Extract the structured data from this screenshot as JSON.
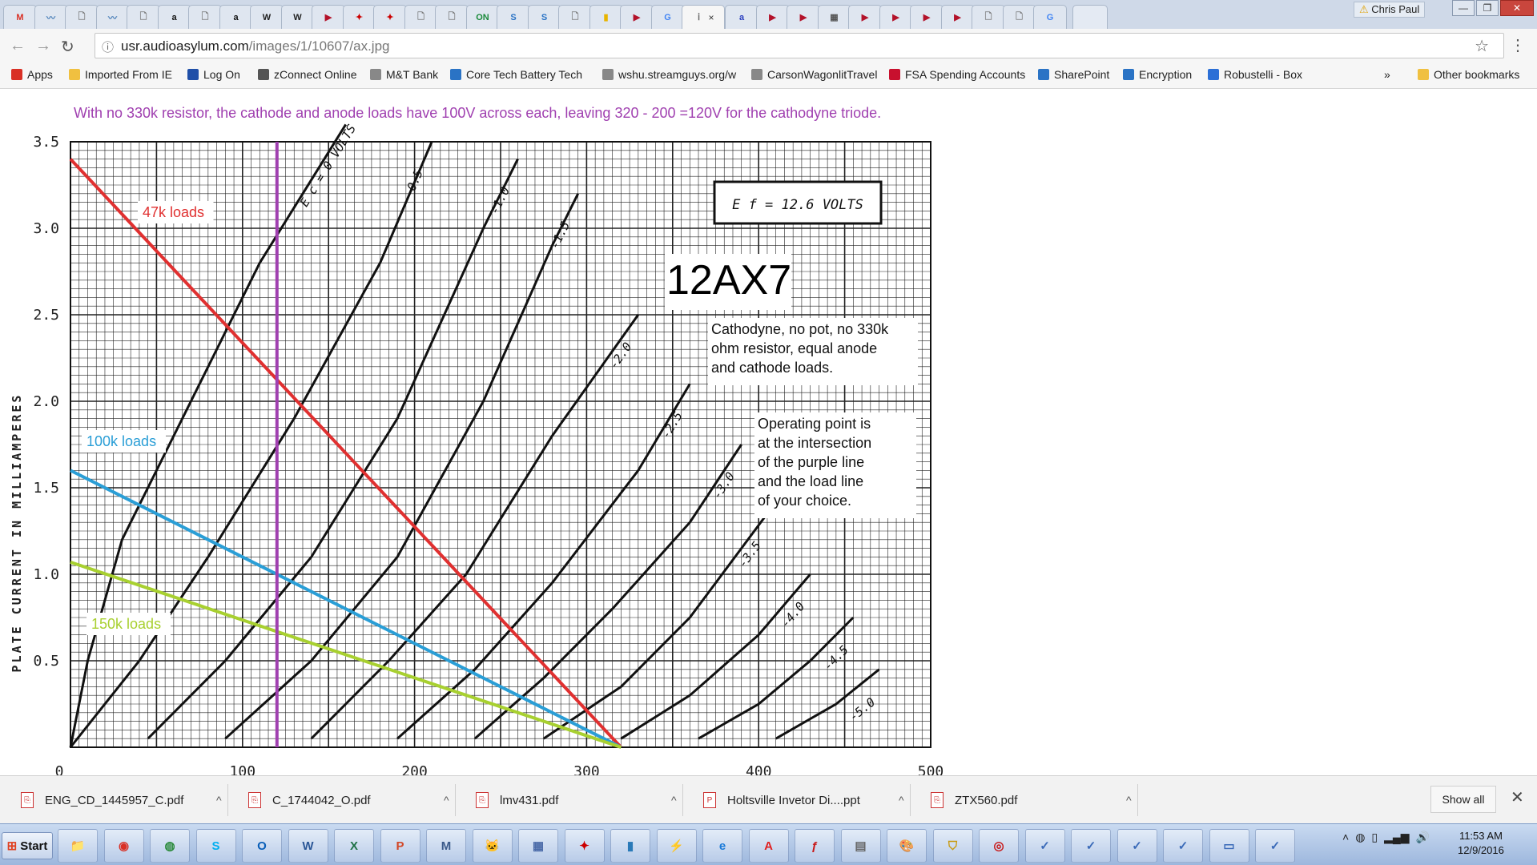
{
  "browser": {
    "profile_name": "Chris Paul",
    "url_host": "usr.audioasylum.com",
    "url_path": "/images/1/10607/ax.jpg",
    "tab_active_close": "×"
  },
  "tabs": [
    {
      "icon": "gmail-icon",
      "glyph": "M",
      "color": "#d93025"
    },
    {
      "icon": "site-icon",
      "glyph": "〰",
      "color": "#4a7fb8"
    },
    {
      "icon": "page-icon",
      "glyph": "🗋",
      "color": "#777"
    },
    {
      "icon": "site-icon",
      "glyph": "〰",
      "color": "#4a7fb8"
    },
    {
      "icon": "page-icon",
      "glyph": "🗋",
      "color": "#777"
    },
    {
      "icon": "amazon-icon",
      "glyph": "a",
      "color": "#111"
    },
    {
      "icon": "page-icon",
      "glyph": "🗋",
      "color": "#777"
    },
    {
      "icon": "amazon-icon",
      "glyph": "a",
      "color": "#111"
    },
    {
      "icon": "wikipedia-icon",
      "glyph": "W",
      "color": "#222"
    },
    {
      "icon": "wikipedia-icon",
      "glyph": "W",
      "color": "#222"
    },
    {
      "icon": "red-site-icon",
      "glyph": "▶",
      "color": "#b3122a"
    },
    {
      "icon": "ti-icon",
      "glyph": "✦",
      "color": "#cc0000"
    },
    {
      "icon": "ti-icon",
      "glyph": "✦",
      "color": "#cc0000"
    },
    {
      "icon": "page-icon",
      "glyph": "🗋",
      "color": "#777"
    },
    {
      "icon": "page-icon",
      "glyph": "🗋",
      "color": "#777"
    },
    {
      "icon": "on-semi-icon",
      "glyph": "ON",
      "color": "#1a8a3a"
    },
    {
      "icon": "sharepoint-icon",
      "glyph": "S",
      "color": "#2a73c5"
    },
    {
      "icon": "sharepoint-icon",
      "glyph": "S",
      "color": "#2a73c5"
    },
    {
      "icon": "page-icon",
      "glyph": "🗋",
      "color": "#777"
    },
    {
      "icon": "flag-icon",
      "glyph": "▮",
      "color": "#e8b400"
    },
    {
      "icon": "red-site-icon",
      "glyph": "▶",
      "color": "#b3122a"
    },
    {
      "icon": "google-icon",
      "glyph": "G",
      "color": "#4285f4"
    },
    {
      "icon": "active-tab-icon",
      "glyph": "ⅰ",
      "color": "#666",
      "active": true
    },
    {
      "icon": "audioasylum-icon",
      "glyph": "a",
      "color": "#2b3fbf"
    },
    {
      "icon": "red-site-icon",
      "glyph": "▶",
      "color": "#b3122a"
    },
    {
      "icon": "red-site-icon",
      "glyph": "▶",
      "color": "#b3122a"
    },
    {
      "icon": "grid-icon",
      "glyph": "▦",
      "color": "#555"
    },
    {
      "icon": "red-site-icon",
      "glyph": "▶",
      "color": "#b3122a"
    },
    {
      "icon": "red-site-icon",
      "glyph": "▶",
      "color": "#b3122a"
    },
    {
      "icon": "red-site-icon",
      "glyph": "▶",
      "color": "#b3122a"
    },
    {
      "icon": "red-site-icon",
      "glyph": "▶",
      "color": "#b3122a"
    },
    {
      "icon": "page-icon",
      "glyph": "🗋",
      "color": "#777"
    },
    {
      "icon": "page-icon",
      "glyph": "🗋",
      "color": "#777"
    },
    {
      "icon": "google-icon",
      "glyph": "G",
      "color": "#4285f4"
    }
  ],
  "bookmarks": [
    {
      "label": "Apps",
      "icon": "apps-icon",
      "color": "#d93025"
    },
    {
      "label": "Imported From IE",
      "icon": "folder-icon",
      "color": "#f0c040"
    },
    {
      "label": "Log On",
      "icon": "logon-icon",
      "color": "#1f4fa8"
    },
    {
      "label": "zConnect Online",
      "icon": "gear-icon",
      "color": "#555"
    },
    {
      "label": "M&T Bank",
      "icon": "page-icon",
      "color": "#888"
    },
    {
      "label": "Core Tech Battery Tech",
      "icon": "sharepoint-icon",
      "color": "#2a73c5"
    },
    {
      "label": "wshu.streamguys.org/w",
      "icon": "page-icon",
      "color": "#888"
    },
    {
      "label": "CarsonWagonlitTravel",
      "icon": "page-icon",
      "color": "#888"
    },
    {
      "label": "FSA Spending Accounts",
      "icon": "fsa-icon",
      "color": "#c8102e"
    },
    {
      "label": "SharePoint",
      "icon": "sharepoint-icon",
      "color": "#2a73c5"
    },
    {
      "label": "Encryption",
      "icon": "sharepoint-icon",
      "color": "#2a73c5"
    },
    {
      "label": "Robustelli - Box",
      "icon": "box-icon",
      "color": "#2b6fd6"
    }
  ],
  "bookmarks_overflow": "»",
  "other_bookmarks": "Other bookmarks",
  "chart_data": {
    "type": "line",
    "title": "12AX7",
    "note_top": "With no 330k resistor, the cathode and anode loads have 100V across each, leaving 320 - 200 =120V for the cathodyne triode.",
    "heater_label": "E f = 12.6 VOLTS",
    "ylabel": "PLATE CURRENT IN MILLIAMPERES",
    "xlabel": "",
    "xlim": [
      0,
      500
    ],
    "ylim": [
      0,
      3.5
    ],
    "x_ticks": [
      "0",
      "100",
      "200",
      "300",
      "400",
      "500"
    ],
    "y_ticks": [
      "0.5",
      "1.0",
      "1.5",
      "2.0",
      "2.5",
      "3.0",
      "3.5"
    ],
    "description_box": "Cathodyne, no pot, no 330k ohm resistor, equal anode and cathode loads.",
    "operating_note": "Operating point is at the intersection of the purple line and the load line of your choice.",
    "grid_curves": [
      {
        "name": "E c = 0 VOLTS",
        "points": [
          [
            0,
            0
          ],
          [
            10,
            0.5
          ],
          [
            30,
            1.2
          ],
          [
            70,
            2.0
          ],
          [
            110,
            2.8
          ],
          [
            160,
            3.6
          ]
        ]
      },
      {
        "name": "-0.5",
        "points": [
          [
            0,
            0
          ],
          [
            40,
            0.5
          ],
          [
            80,
            1.1
          ],
          [
            130,
            1.9
          ],
          [
            180,
            2.8
          ],
          [
            210,
            3.5
          ]
        ]
      },
      {
        "name": "-1.0",
        "points": [
          [
            45,
            0.05
          ],
          [
            90,
            0.5
          ],
          [
            140,
            1.1
          ],
          [
            190,
            1.9
          ],
          [
            240,
            3.0
          ],
          [
            260,
            3.4
          ]
        ]
      },
      {
        "name": "-1.5",
        "points": [
          [
            90,
            0.05
          ],
          [
            140,
            0.5
          ],
          [
            190,
            1.1
          ],
          [
            240,
            2.0
          ],
          [
            280,
            2.9
          ],
          [
            295,
            3.2
          ]
        ]
      },
      {
        "name": "-2.0",
        "points": [
          [
            140,
            0.05
          ],
          [
            185,
            0.5
          ],
          [
            230,
            1.0
          ],
          [
            280,
            1.8
          ],
          [
            330,
            2.5
          ]
        ]
      },
      {
        "name": "-2.5",
        "points": [
          [
            190,
            0.05
          ],
          [
            235,
            0.45
          ],
          [
            280,
            0.95
          ],
          [
            330,
            1.6
          ],
          [
            360,
            2.1
          ]
        ]
      },
      {
        "name": "-3.0",
        "points": [
          [
            235,
            0.05
          ],
          [
            275,
            0.4
          ],
          [
            315,
            0.8
          ],
          [
            360,
            1.3
          ],
          [
            390,
            1.75
          ]
        ]
      },
      {
        "name": "-3.5",
        "points": [
          [
            275,
            0.05
          ],
          [
            320,
            0.35
          ],
          [
            360,
            0.75
          ],
          [
            405,
            1.35
          ]
        ]
      },
      {
        "name": "-4.0",
        "points": [
          [
            320,
            0.05
          ],
          [
            360,
            0.3
          ],
          [
            400,
            0.65
          ],
          [
            430,
            1.0
          ]
        ]
      },
      {
        "name": "-4.5",
        "points": [
          [
            365,
            0.05
          ],
          [
            400,
            0.25
          ],
          [
            430,
            0.5
          ],
          [
            455,
            0.75
          ]
        ]
      },
      {
        "name": "-5.0",
        "points": [
          [
            410,
            0.05
          ],
          [
            445,
            0.25
          ],
          [
            470,
            0.45
          ]
        ]
      }
    ],
    "series": [
      {
        "name": "47k loads",
        "color": "#e03030",
        "points": [
          [
            0,
            3.4
          ],
          [
            320,
            0
          ]
        ]
      },
      {
        "name": "100k loads",
        "color": "#2a9ed6",
        "points": [
          [
            0,
            1.6
          ],
          [
            320,
            0
          ]
        ]
      },
      {
        "name": "150k loads",
        "color": "#a8d030",
        "points": [
          [
            0,
            1.07
          ],
          [
            320,
            0
          ]
        ]
      },
      {
        "name": "",
        "color": "#a040b0",
        "points": [
          [
            120,
            0
          ],
          [
            120,
            3.5
          ]
        ]
      }
    ]
  },
  "downloads": [
    {
      "name": "ENG_CD_1445957_C.pdf",
      "icon": "pdf-icon"
    },
    {
      "name": "C_1744042_O.pdf",
      "icon": "pdf-icon"
    },
    {
      "name": "lmv431.pdf",
      "icon": "pdf-icon"
    },
    {
      "name": "Holtsville Invetor Di....ppt",
      "icon": "ppt-icon"
    },
    {
      "name": "ZTX560.pdf",
      "icon": "pdf-icon"
    }
  ],
  "download_bar": {
    "show_all": "Show all",
    "close": "✕",
    "caret": "^"
  },
  "taskbar": {
    "start": "Start",
    "apps": [
      {
        "icon": "explorer-folder-icon",
        "glyph": "📁",
        "color": "#e0b030"
      },
      {
        "icon": "chrome-icon",
        "glyph": "◉",
        "color": "#d93025"
      },
      {
        "icon": "globe-icon",
        "glyph": "◍",
        "color": "#2a8a3a"
      },
      {
        "icon": "skype-icon",
        "glyph": "S",
        "color": "#00aff0"
      },
      {
        "icon": "outlook-icon",
        "glyph": "O",
        "color": "#0a5fb8"
      },
      {
        "icon": "word-icon",
        "glyph": "W",
        "color": "#2b5797"
      },
      {
        "icon": "excel-icon",
        "glyph": "X",
        "color": "#1e7145"
      },
      {
        "icon": "powerpoint-icon",
        "glyph": "P",
        "color": "#d24726"
      },
      {
        "icon": "mathcad-icon",
        "glyph": "M",
        "color": "#3a5a8a"
      },
      {
        "icon": "cat-icon",
        "glyph": "🐱",
        "color": "#555"
      },
      {
        "icon": "network-icon",
        "glyph": "▦",
        "color": "#4a6aa8"
      },
      {
        "icon": "ti-icon",
        "glyph": "✦",
        "color": "#cc0000"
      },
      {
        "icon": "book-icon",
        "glyph": "▮",
        "color": "#2a7ab8"
      },
      {
        "icon": "lightning-icon",
        "glyph": "⚡",
        "color": "#2a9a3a"
      },
      {
        "icon": "ie-icon",
        "glyph": "e",
        "color": "#1a7ad8"
      },
      {
        "icon": "acrobat-icon",
        "glyph": "A",
        "color": "#e02020"
      },
      {
        "icon": "flash-icon",
        "glyph": "ƒ",
        "color": "#c81818"
      },
      {
        "icon": "calculator-icon",
        "glyph": "▤",
        "color": "#666"
      },
      {
        "icon": "paint-icon",
        "glyph": "🎨",
        "color": "#888"
      },
      {
        "icon": "shield-icon",
        "glyph": "⛉",
        "color": "#c89a10"
      },
      {
        "icon": "media-icon",
        "glyph": "◎",
        "color": "#c81818"
      },
      {
        "icon": "ltspice-icon",
        "glyph": "✓",
        "color": "#3a6ab8"
      },
      {
        "icon": "ltspice-icon",
        "glyph": "✓",
        "color": "#3a6ab8"
      },
      {
        "icon": "ltspice-icon",
        "glyph": "✓",
        "color": "#3a6ab8"
      },
      {
        "icon": "ltspice-icon",
        "glyph": "✓",
        "color": "#3a6ab8"
      },
      {
        "icon": "monitor-icon",
        "glyph": "▭",
        "color": "#3a6ab8"
      },
      {
        "icon": "ltspice-icon",
        "glyph": "✓",
        "color": "#3a6ab8"
      }
    ],
    "clock_time": "11:53 AM",
    "clock_date": "12/9/2016"
  }
}
